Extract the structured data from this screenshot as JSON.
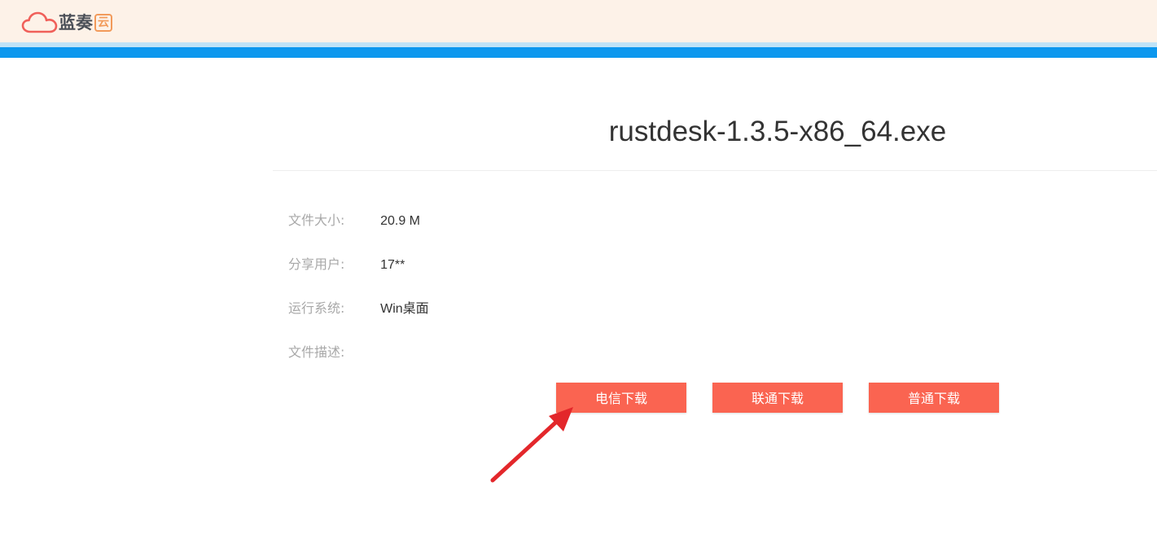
{
  "header": {
    "logo_text": "蓝奏",
    "logo_badge": "云",
    "colors": {
      "background": "#fdf2e8",
      "accent_light": "#bfe3f7",
      "accent_blue": "#0c97ee",
      "cloud": "#f0605a"
    }
  },
  "file": {
    "title": "rustdesk-1.3.5-x86_64.exe"
  },
  "info": [
    {
      "label": "文件大小:",
      "value": "20.9 M"
    },
    {
      "label": "分享用户:",
      "value": "17**"
    },
    {
      "label": "运行系统:",
      "value": "Win桌面"
    },
    {
      "label": "文件描述:",
      "value": ""
    }
  ],
  "buttons": {
    "telecom": "电信下载",
    "unicom": "联通下载",
    "normal": "普通下载",
    "color": "#fa6451"
  },
  "annotation": {
    "arrow_color": "#e3272b"
  }
}
